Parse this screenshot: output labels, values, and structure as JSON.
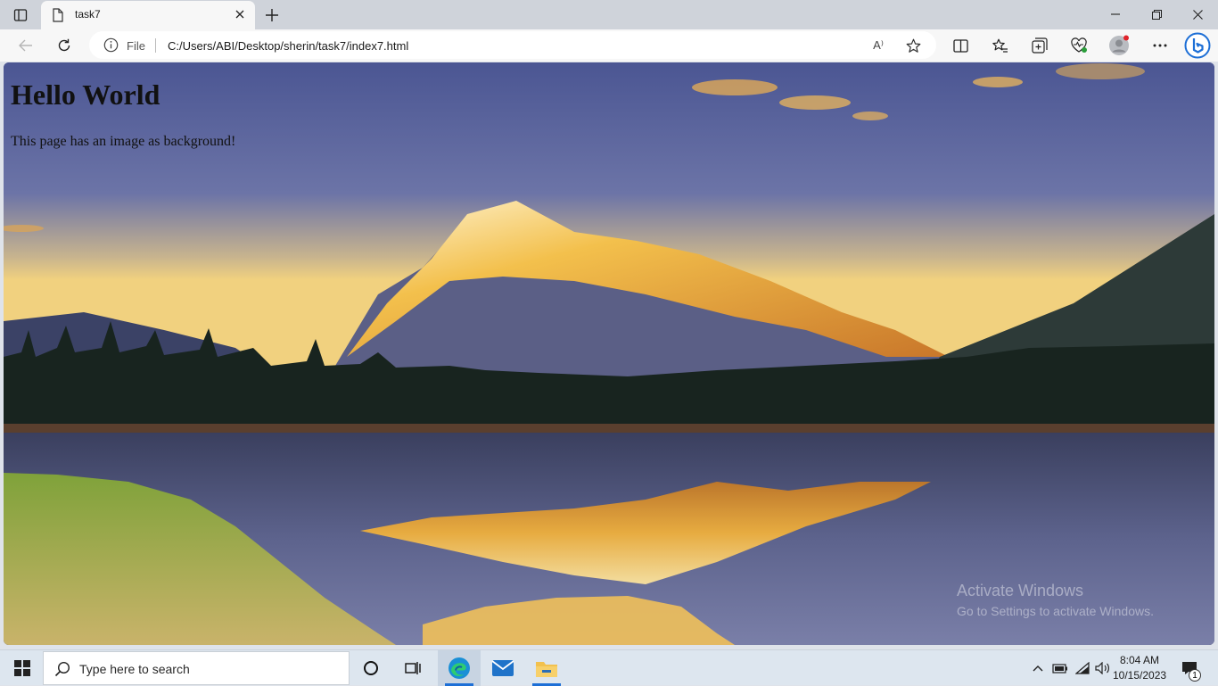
{
  "browser": {
    "tab": {
      "title": "task7"
    },
    "address": {
      "scheme_label": "File",
      "url": "C:/Users/ABI/Desktop/sherin/task7/index7.html"
    },
    "read_aloud_label": "A⁾"
  },
  "page": {
    "heading": "Hello World",
    "paragraph": "This page has an image as background!"
  },
  "watermark": {
    "line1": "Activate Windows",
    "line2": "Go to Settings to activate Windows."
  },
  "taskbar": {
    "search_placeholder": "Type here to search",
    "time": "8:04 AM",
    "date": "10/15/2023",
    "notification_count": "1"
  },
  "colors": {
    "edge_accent": "#1d6fd6",
    "profile_dot": "#e0242b"
  }
}
